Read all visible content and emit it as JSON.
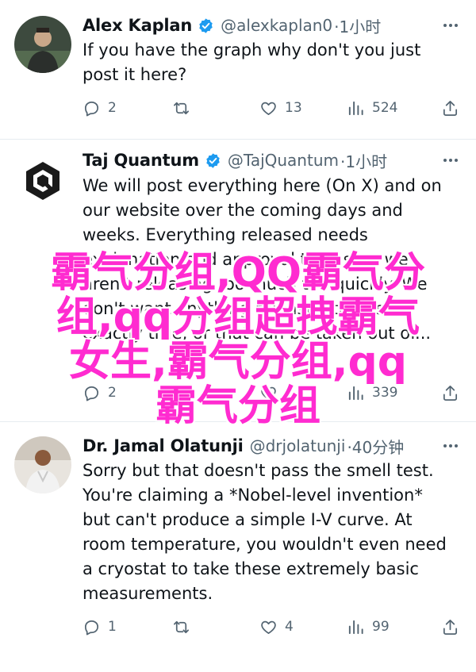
{
  "colors": {
    "verified": "#1d9bf0",
    "muted": "#536471",
    "watermark": "#ff2bd0"
  },
  "tweets": [
    {
      "name": "Alex Kaplan",
      "handle": "@alexkaplan0",
      "time": "·1小时",
      "text": "If you have the graph why don't you just post it here?",
      "replies": "2",
      "reposts": "",
      "likes": "13",
      "views": "524"
    },
    {
      "name": "Taj Quantum",
      "handle": "@TajQuantum",
      "time": "·1小时",
      "text": "We will post everything here (On X) and on our website over the coming days and weeks. Everything released needs explanation and approval to ensure we aren't releasing too much too quickly. We don't want anything released that isn't exactly true, or that can be taken out of...",
      "replies": "2",
      "reposts": "",
      "likes": "",
      "views": "339"
    },
    {
      "name": "Dr. Jamal Olatunji",
      "handle": "@drjolatunji",
      "time": "·40分钟",
      "text": "Sorry but that doesn't pass the smell test. You're claiming a *Nobel-level invention* but can't produce a simple I-V curve. At room temperature, you wouldn't even need a cryostat to take these extremely basic measurements.",
      "replies": "1",
      "reposts": "",
      "likes": "4",
      "views": "99"
    }
  ],
  "watermark": {
    "line1": "霸气分组,QQ霸气分",
    "line2": "组,qq分组超拽霸气",
    "line3": "女生,霸气分组,qq",
    "line4": "霸气分组"
  }
}
